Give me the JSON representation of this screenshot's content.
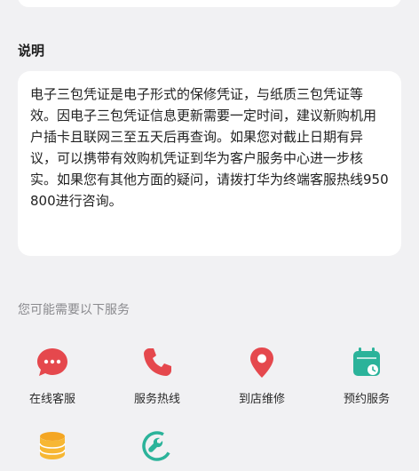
{
  "description_section": {
    "title": "说明",
    "text": "电子三包凭证是电子形式的保修凭证，与纸质三包凭证等效。因电子三包凭证信息更新需要一定时间，建议新购机用户插卡且联网三至五天后再查询。如果您对截止日期有异议，可以携带有效购机凭证到华为客户服务中心进一步核实。如果您有其他方面的疑问，请拨打华为终端客服热线950800进行咨询。"
  },
  "services": {
    "title": "您可能需要以下服务",
    "items": [
      {
        "label": "在线客服",
        "icon": "chat-bubble-icon",
        "color": "#e5484d"
      },
      {
        "label": "服务热线",
        "icon": "phone-icon",
        "color": "#e5484d"
      },
      {
        "label": "到店维修",
        "icon": "location-pin-icon",
        "color": "#e5484d"
      },
      {
        "label": "预约服务",
        "icon": "calendar-clock-icon",
        "color": "#2bb39a"
      },
      {
        "label": "",
        "icon": "coin-stack-icon",
        "color": "#f4a623"
      },
      {
        "label": "",
        "icon": "wrench-icon",
        "color": "#2bb39a"
      }
    ]
  }
}
